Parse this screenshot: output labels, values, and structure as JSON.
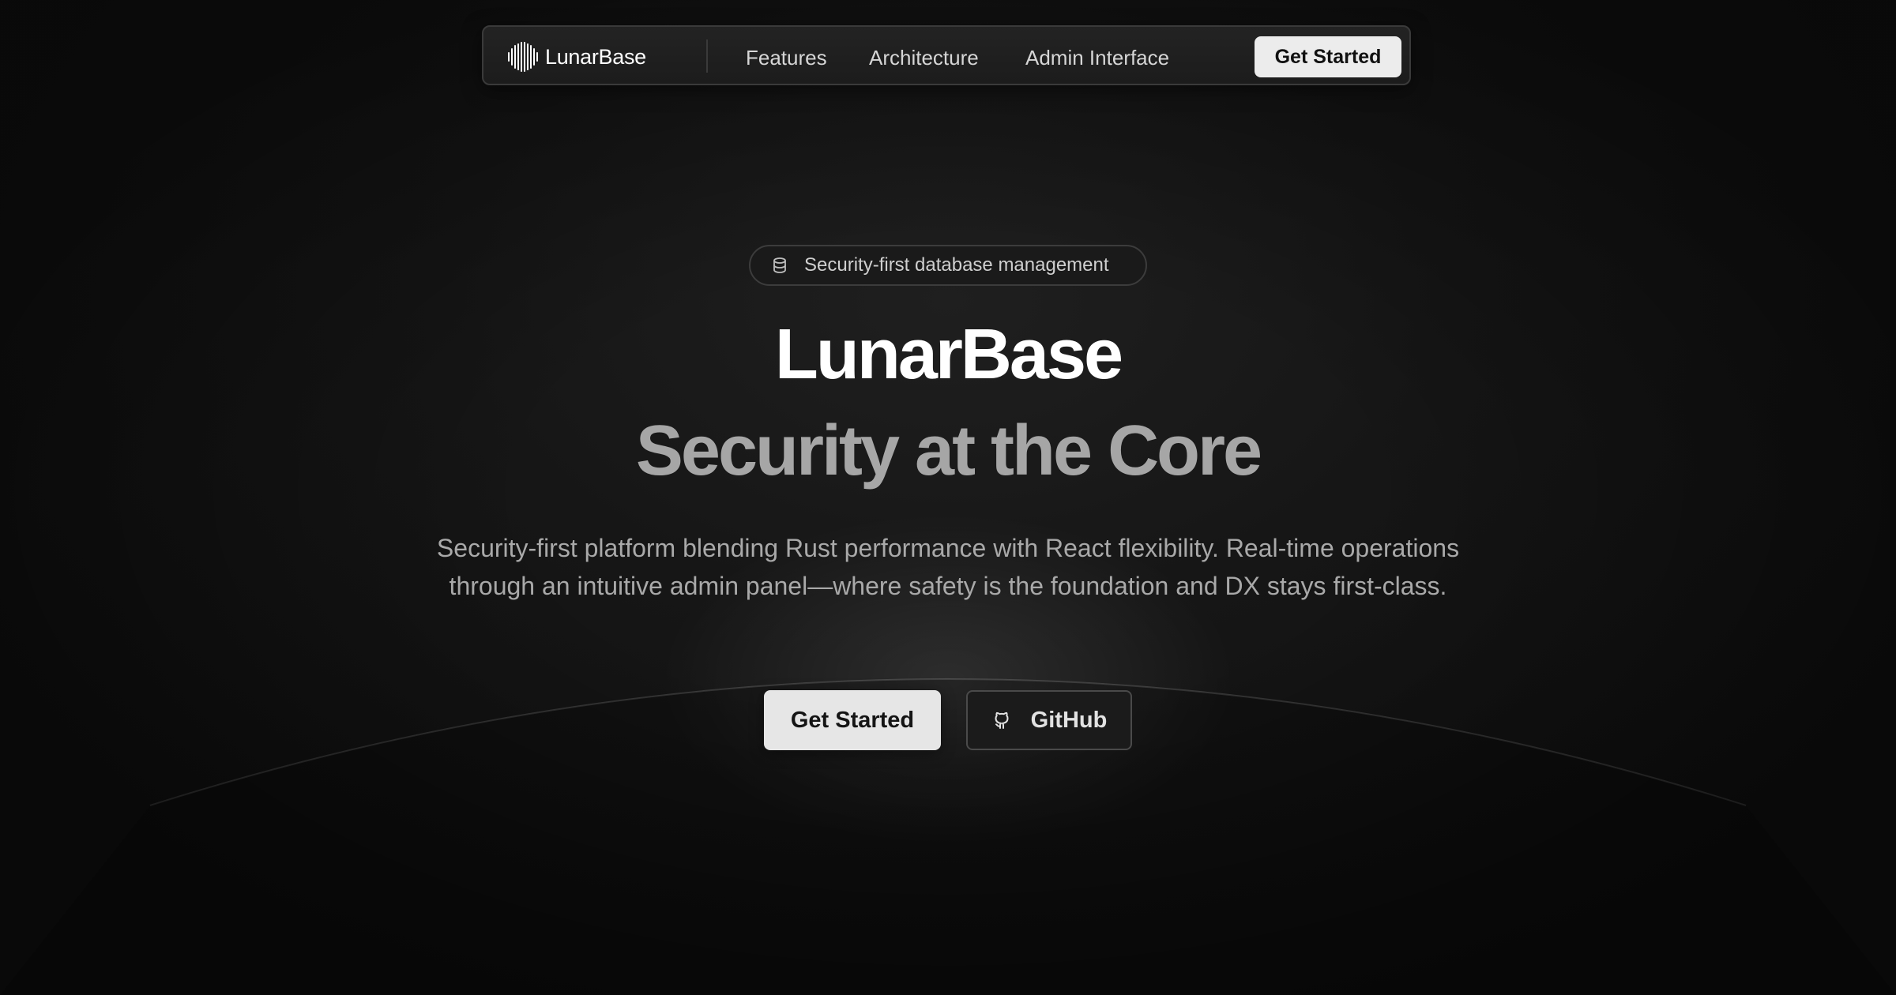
{
  "nav": {
    "brand": "LunarBase",
    "links": [
      "Features",
      "Architecture",
      "Admin Interface"
    ],
    "cta_label": "Get Started"
  },
  "hero": {
    "badge": "Security-first database management",
    "title": "LunarBase",
    "tagline": "Security at the Core",
    "subtitle": "Security-first platform blending Rust performance with React flexibility. Real-time operations through an intuitive admin panel—where safety is the foundation and DX stays first-class.",
    "primary_cta": "Get Started",
    "secondary_cta": "GitHub"
  },
  "icons": {
    "logo": "waveform-logo-icon",
    "badge": "database-icon",
    "github": "github-icon"
  },
  "colors": {
    "background": "#121212",
    "nav_background": "#1f1f1f",
    "primary_button": "#e6e6e6",
    "headline": "#ffffff",
    "tagline": "#a6a6a6",
    "subtitle": "#a9a9a9"
  }
}
